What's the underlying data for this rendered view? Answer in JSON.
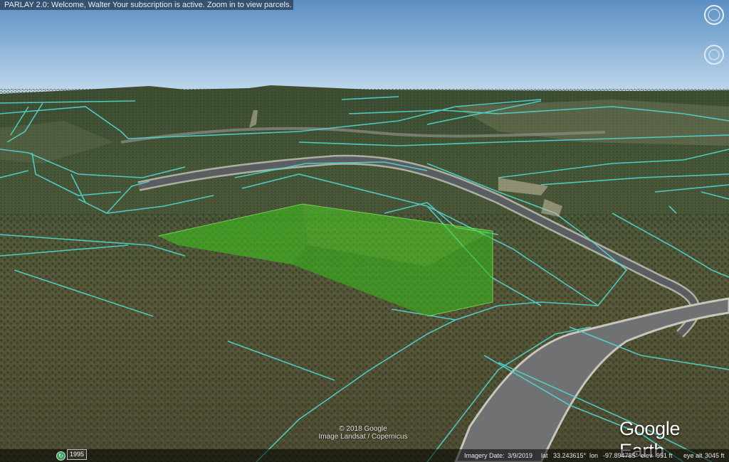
{
  "banner": {
    "text": "PARLAY 2.0: Welcome, Walter Your subscription is active. Zoom in to view parcels."
  },
  "attribution": {
    "copyright": "© 2018 Google",
    "imagery": "Image Landsat / Copernicus"
  },
  "logo": {
    "text": "Google Earth"
  },
  "statusbar": {
    "year": "1995",
    "imagery_label": "Imagery Date:",
    "imagery_date": "3/9/2019",
    "lat_label": "lat",
    "lat": "33.243615°",
    "lon_label": "lon",
    "lon": "-97.894785°",
    "elev_label": "elev",
    "elev": "951 ft",
    "eye_label": "eye alt",
    "eye_alt": "3045 ft"
  },
  "colors": {
    "parcel_lines": "#4fd6d0",
    "parcel_fill": "#3fbf1f",
    "sky_top": "#5a8fc4",
    "sky_bottom": "#b9d4ea"
  },
  "icons": {
    "nav": "compass-ring-icon",
    "look": "look-ring-icon",
    "history": "historical-imagery-icon"
  }
}
